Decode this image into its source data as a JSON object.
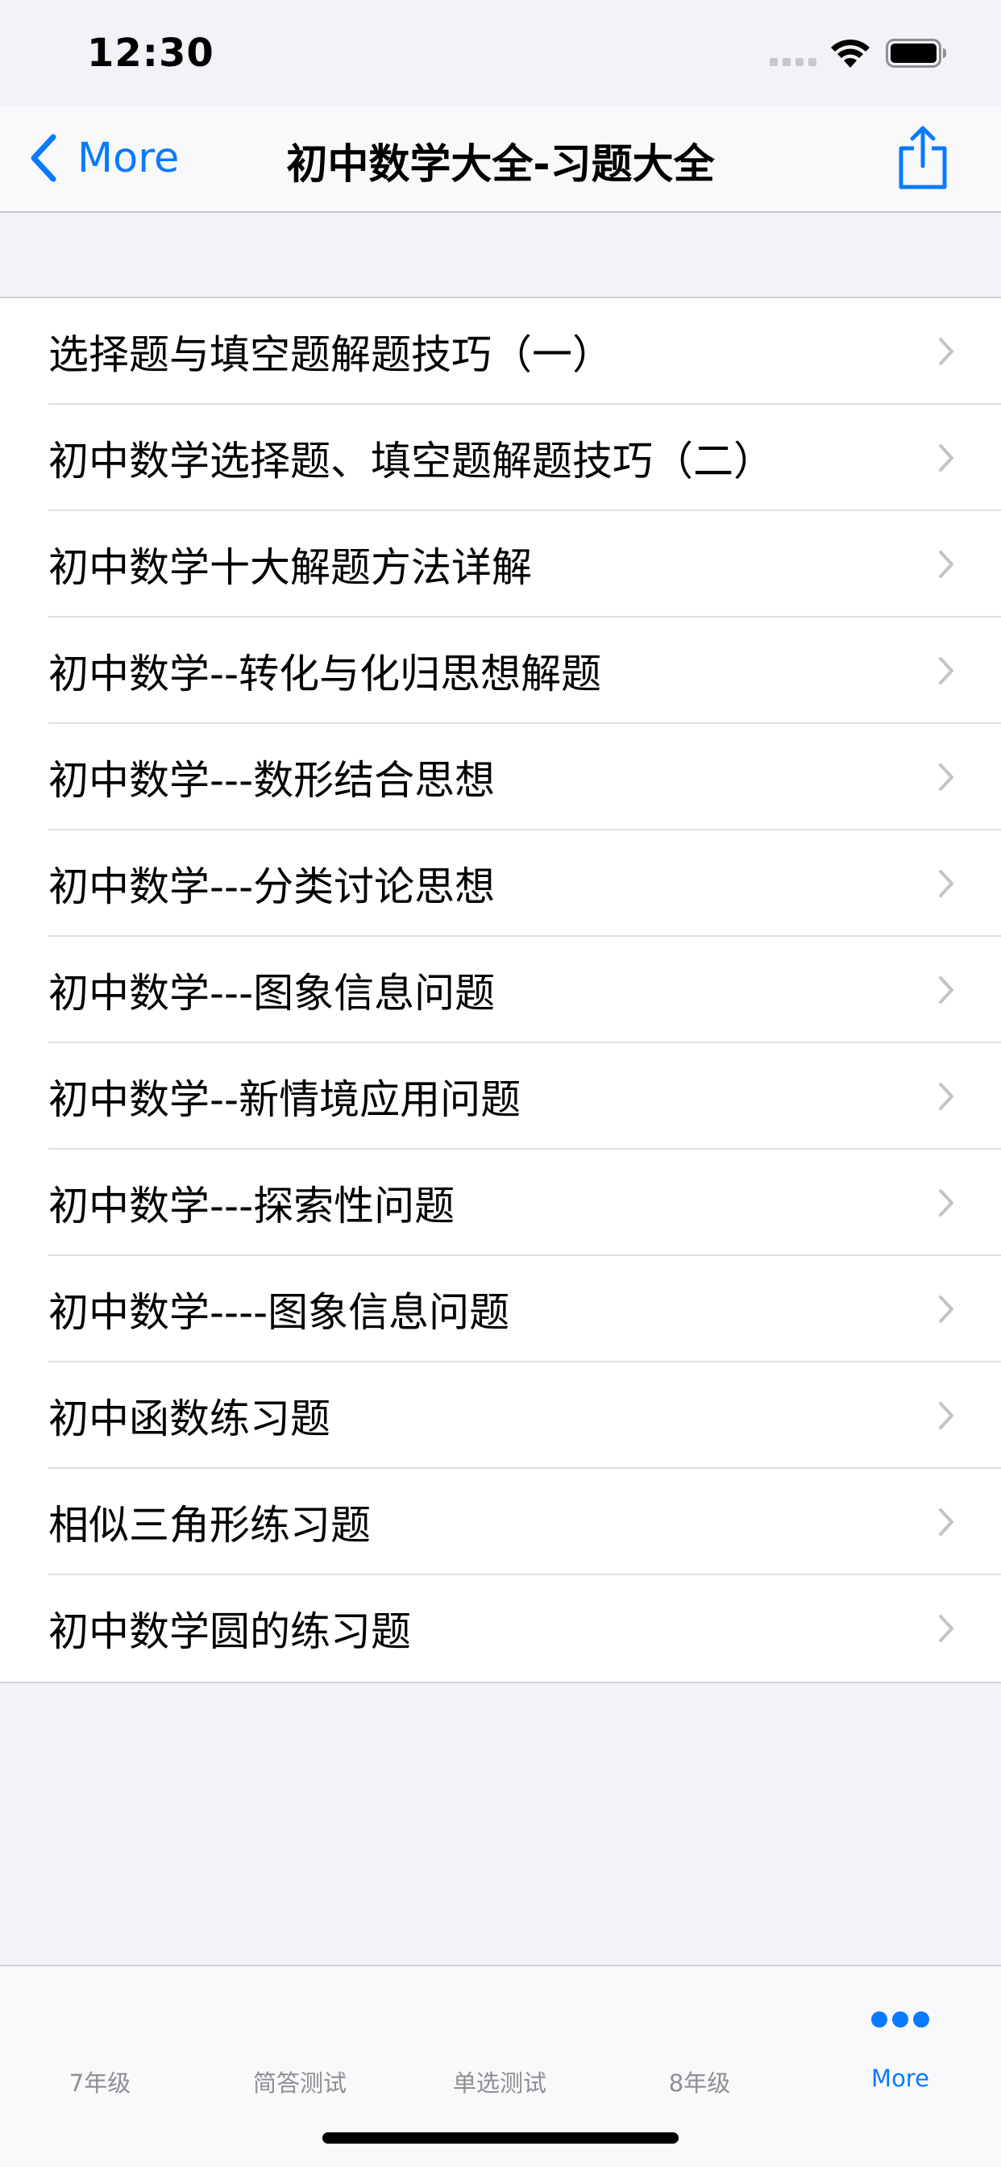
{
  "status_bar": {
    "time": "12:30"
  },
  "nav": {
    "back_label": "More",
    "title": "初中数学大全-习题大全",
    "share_icon": "share-icon"
  },
  "list": {
    "items": [
      {
        "label": "选择题与填空题解题技巧（一）"
      },
      {
        "label": "初中数学选择题、填空题解题技巧（二）"
      },
      {
        "label": "初中数学十大解题方法详解"
      },
      {
        "label": "初中数学--转化与化归思想解题"
      },
      {
        "label": "初中数学---数形结合思想"
      },
      {
        "label": "初中数学---分类讨论思想"
      },
      {
        "label": "初中数学---图象信息问题"
      },
      {
        "label": "初中数学--新情境应用问题"
      },
      {
        "label": "初中数学---探索性问题"
      },
      {
        "label": "初中数学----图象信息问题"
      },
      {
        "label": "初中函数练习题"
      },
      {
        "label": "相似三角形练习题"
      },
      {
        "label": "初中数学圆的练习题"
      }
    ]
  },
  "tab_bar": {
    "tabs": [
      {
        "label": "7年级",
        "active": false
      },
      {
        "label": "简答测试",
        "active": false
      },
      {
        "label": "单选测试",
        "active": false
      },
      {
        "label": "8年级",
        "active": false
      },
      {
        "label": "More",
        "active": true,
        "icon": "more-dots-icon"
      }
    ]
  },
  "colors": {
    "accent": "#0a7aff",
    "inactive_tab": "#8e8e93",
    "background": "#f2f2f7"
  }
}
